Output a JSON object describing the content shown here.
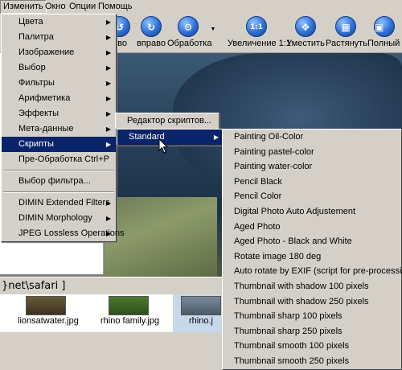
{
  "menubar": [
    "Изменить",
    "Окно",
    "Опции",
    "Помощь"
  ],
  "toolbar": [
    {
      "label": "ево",
      "icon": "arrow-left-icon"
    },
    {
      "label": "вправо",
      "icon": "arrow-right-icon"
    },
    {
      "label": "Обработка",
      "icon": "gear-icon"
    },
    {
      "label": "Увеличение 1:1",
      "icon_text": "1:1",
      "icon": "zoom-1-1-icon"
    },
    {
      "label": "Уместить",
      "icon": "fit-icon"
    },
    {
      "label": "Растянуть",
      "icon": "stretch-icon"
    },
    {
      "label": "Полный эк",
      "icon": "fullscreen-icon"
    }
  ],
  "menu_main": {
    "items": [
      {
        "label": "Цвета",
        "submenu": true
      },
      {
        "label": "Палитра",
        "submenu": true
      },
      {
        "label": "Изображение",
        "submenu": true
      },
      {
        "label": "Выбор",
        "submenu": true
      },
      {
        "label": "Фильтры",
        "submenu": true
      },
      {
        "label": "Арифметика",
        "submenu": true
      },
      {
        "label": "Эффекты",
        "submenu": true
      },
      {
        "label": "Мета-данные",
        "submenu": true
      },
      {
        "label": "Скрипты",
        "submenu": true,
        "selected": true
      },
      {
        "label": "Пре-Обработка",
        "shortcut": "Ctrl+P"
      },
      {
        "label": "Выбор фильтра..."
      },
      {
        "label": "DIMIN Extended Filters",
        "submenu": true
      },
      {
        "label": "DIMIN Morphology",
        "submenu": true
      },
      {
        "label": "JPEG Lossless Operations",
        "submenu": true
      }
    ]
  },
  "menu_scripts": {
    "items": [
      {
        "label": "Редактор скриптов..."
      }
    ]
  },
  "menu_scripts2": {
    "items": [
      {
        "label": "Standard",
        "submenu": true,
        "selected": true
      }
    ]
  },
  "menu_standard": {
    "items": [
      "Painting Oil-Color",
      "Painting pastel-color",
      "Painting water-color",
      "Pencil Black",
      "Pencil Color",
      "Digital Photo Auto Adjustement",
      "Aged Photo",
      "Aged Photo - Black and White",
      "Rotate image 180 deg",
      "Auto rotate by EXIF (script for pre-processing)",
      "Thumbnail with shadow 100 pixels",
      "Thumbnail with shadow 250 pixels",
      "Thumbnail sharp 100 pixels",
      "Thumbnail sharp 250 pixels",
      "Thumbnail smooth 100 pixels",
      "Thumbnail smooth 250 pixels"
    ]
  },
  "path": "}net\\safari ]",
  "thumbnails": [
    "lionsatwater.jpg",
    "rhino family.jpg",
    "rhino.j"
  ]
}
